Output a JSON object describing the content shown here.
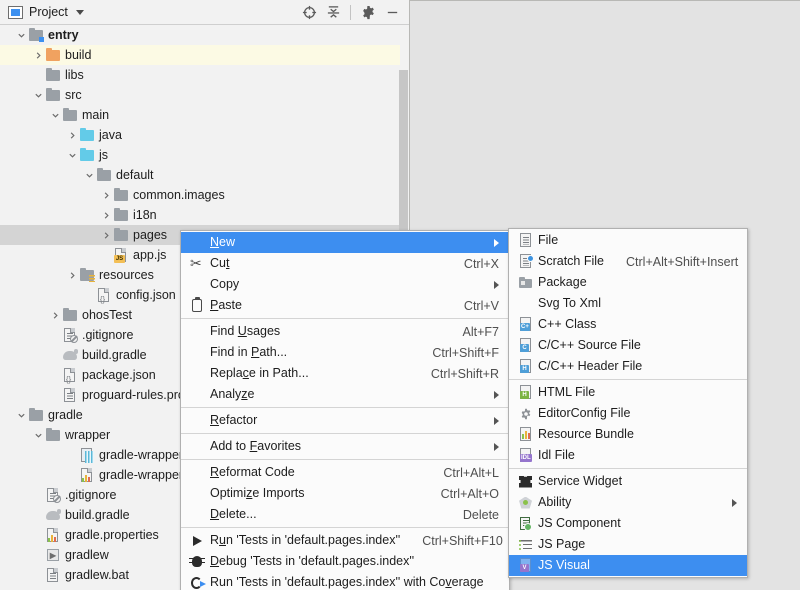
{
  "window": {
    "tool_window_title": "Project",
    "actions": [
      {
        "name": "locate-icon",
        "label": "Select Opened File"
      },
      {
        "name": "collapse-all-icon",
        "label": "Collapse All"
      },
      {
        "name": "gear-icon",
        "label": "Settings"
      },
      {
        "name": "minimize-icon",
        "label": "Hide"
      }
    ]
  },
  "tree": {
    "nodes": [
      {
        "label": "entry",
        "indent": 0,
        "twisty": "down",
        "icon": "folder-module",
        "bold": true,
        "state": "normal"
      },
      {
        "label": "build",
        "indent": 1,
        "twisty": "right",
        "icon": "folder-excluded",
        "bold": false,
        "state": "excluded"
      },
      {
        "label": "libs",
        "indent": 1,
        "twisty": "none",
        "icon": "folder-gray",
        "bold": false,
        "state": "normal"
      },
      {
        "label": "src",
        "indent": 1,
        "twisty": "down",
        "icon": "folder-gray",
        "bold": false,
        "state": "normal"
      },
      {
        "label": "main",
        "indent": 2,
        "twisty": "down",
        "icon": "folder-gray",
        "bold": false,
        "state": "normal"
      },
      {
        "label": "java",
        "indent": 3,
        "twisty": "right",
        "icon": "folder-source",
        "bold": false,
        "state": "normal"
      },
      {
        "label": "js",
        "indent": 3,
        "twisty": "down",
        "icon": "folder-source",
        "bold": false,
        "state": "normal"
      },
      {
        "label": "default",
        "indent": 4,
        "twisty": "down",
        "icon": "folder-gray",
        "bold": false,
        "state": "normal"
      },
      {
        "label": "common.images",
        "indent": 5,
        "twisty": "right",
        "icon": "folder-gray",
        "bold": false,
        "state": "normal"
      },
      {
        "label": "i18n",
        "indent": 5,
        "twisty": "right",
        "icon": "folder-gray",
        "bold": false,
        "state": "normal"
      },
      {
        "label": "pages",
        "indent": 5,
        "twisty": "right",
        "icon": "folder-gray",
        "bold": false,
        "state": "selected"
      },
      {
        "label": "app.js",
        "indent": 5,
        "twisty": "none",
        "icon": "file-js",
        "bold": false,
        "state": "normal"
      },
      {
        "label": "resources",
        "indent": 3,
        "twisty": "right",
        "icon": "folder-resource",
        "bold": false,
        "state": "normal"
      },
      {
        "label": "config.json",
        "indent": 4,
        "twisty": "none",
        "icon": "file-json",
        "bold": false,
        "state": "normal"
      },
      {
        "label": "ohosTest",
        "indent": 2,
        "twisty": "right",
        "icon": "folder-gray",
        "bold": false,
        "state": "normal"
      },
      {
        "label": ".gitignore",
        "indent": 2,
        "twisty": "none",
        "icon": "file-ignored",
        "bold": false,
        "state": "normal"
      },
      {
        "label": "build.gradle",
        "indent": 2,
        "twisty": "none",
        "icon": "file-gradle",
        "bold": false,
        "state": "normal"
      },
      {
        "label": "package.json",
        "indent": 2,
        "twisty": "none",
        "icon": "file-json",
        "bold": false,
        "state": "normal"
      },
      {
        "label": "proguard-rules.pro",
        "indent": 2,
        "twisty": "none",
        "icon": "file-text",
        "bold": false,
        "state": "normal"
      },
      {
        "label": "gradle",
        "indent": 0,
        "twisty": "down",
        "icon": "folder-gray",
        "bold": false,
        "state": "normal"
      },
      {
        "label": "wrapper",
        "indent": 1,
        "twisty": "down",
        "icon": "folder-gray",
        "bold": false,
        "state": "normal"
      },
      {
        "label": "gradle-wrapper.",
        "indent": 3,
        "twisty": "none",
        "icon": "file-archive",
        "bold": false,
        "state": "normal"
      },
      {
        "label": "gradle-wrapper.",
        "indent": 3,
        "twisty": "none",
        "icon": "file-properties",
        "bold": false,
        "state": "normal"
      },
      {
        "label": ".gitignore",
        "indent": 1,
        "twisty": "none",
        "icon": "file-ignored",
        "bold": false,
        "state": "normal"
      },
      {
        "label": "build.gradle",
        "indent": 1,
        "twisty": "none",
        "icon": "file-gradle",
        "bold": false,
        "state": "normal"
      },
      {
        "label": "gradle.properties",
        "indent": 1,
        "twisty": "none",
        "icon": "file-properties",
        "bold": false,
        "state": "normal"
      },
      {
        "label": "gradlew",
        "indent": 1,
        "twisty": "none",
        "icon": "file-script",
        "bold": false,
        "state": "normal"
      },
      {
        "label": "gradlew.bat",
        "indent": 1,
        "twisty": "none",
        "icon": "file-text",
        "bold": false,
        "state": "normal"
      }
    ]
  },
  "context_menu": {
    "items": [
      {
        "kind": "item",
        "label": "New",
        "mnemonic": "N",
        "accel": "",
        "icon": "none",
        "submenu": true,
        "highlighted": true
      },
      {
        "kind": "item",
        "label": "Cut",
        "mnemonic": "t",
        "accel": "Ctrl+X",
        "icon": "scissors-icon",
        "submenu": false,
        "highlighted": false
      },
      {
        "kind": "item",
        "label": "Copy",
        "mnemonic": "",
        "accel": "",
        "icon": "none",
        "submenu": true,
        "highlighted": false
      },
      {
        "kind": "item",
        "label": "Paste",
        "mnemonic": "P",
        "accel": "Ctrl+V",
        "icon": "clipboard-icon",
        "submenu": false,
        "highlighted": false
      },
      {
        "kind": "separator"
      },
      {
        "kind": "item",
        "label": "Find Usages",
        "mnemonic": "U",
        "accel": "Alt+F7",
        "icon": "none",
        "submenu": false,
        "highlighted": false
      },
      {
        "kind": "item",
        "label": "Find in Path...",
        "mnemonic": "P",
        "accel": "Ctrl+Shift+F",
        "icon": "none",
        "submenu": false,
        "highlighted": false
      },
      {
        "kind": "item",
        "label": "Replace in Path...",
        "mnemonic": "c",
        "accel": "Ctrl+Shift+R",
        "icon": "none",
        "submenu": false,
        "highlighted": false
      },
      {
        "kind": "item",
        "label": "Analyze",
        "mnemonic": "z",
        "accel": "",
        "icon": "none",
        "submenu": true,
        "highlighted": false
      },
      {
        "kind": "separator"
      },
      {
        "kind": "item",
        "label": "Refactor",
        "mnemonic": "R",
        "accel": "",
        "icon": "none",
        "submenu": true,
        "highlighted": false
      },
      {
        "kind": "separator"
      },
      {
        "kind": "item",
        "label": "Add to Favorites",
        "mnemonic": "F",
        "accel": "",
        "icon": "none",
        "submenu": true,
        "highlighted": false
      },
      {
        "kind": "separator"
      },
      {
        "kind": "item",
        "label": "Reformat Code",
        "mnemonic": "R",
        "accel": "Ctrl+Alt+L",
        "icon": "none",
        "submenu": false,
        "highlighted": false
      },
      {
        "kind": "item",
        "label": "Optimize Imports",
        "mnemonic": "z",
        "accel": "Ctrl+Alt+O",
        "icon": "none",
        "submenu": false,
        "highlighted": false
      },
      {
        "kind": "item",
        "label": "Delete...",
        "mnemonic": "D",
        "accel": "Delete",
        "icon": "none",
        "submenu": false,
        "highlighted": false
      },
      {
        "kind": "separator"
      },
      {
        "kind": "item",
        "label": "Run 'Tests in 'default.pages.index''",
        "mnemonic": "u",
        "accel": "Ctrl+Shift+F10",
        "icon": "run-icon",
        "submenu": false,
        "highlighted": false
      },
      {
        "kind": "item",
        "label": "Debug 'Tests in 'default.pages.index''",
        "mnemonic": "D",
        "accel": "",
        "icon": "debug-icon",
        "submenu": false,
        "highlighted": false
      },
      {
        "kind": "item",
        "label": "Run 'Tests in 'default.pages.index'' with Coverage",
        "mnemonic": "v",
        "accel": "",
        "icon": "coverage-icon",
        "submenu": false,
        "highlighted": false
      }
    ]
  },
  "new_submenu": {
    "items": [
      {
        "kind": "item",
        "label": "File",
        "accel": "",
        "icon": "file-icon",
        "submenu": false,
        "highlighted": false
      },
      {
        "kind": "item",
        "label": "Scratch File",
        "accel": "Ctrl+Alt+Shift+Insert",
        "icon": "scratch-file-icon",
        "submenu": false,
        "highlighted": false
      },
      {
        "kind": "item",
        "label": "Package",
        "accel": "",
        "icon": "package-icon",
        "submenu": false,
        "highlighted": false
      },
      {
        "kind": "item",
        "label": "Svg To Xml",
        "accel": "",
        "icon": "none",
        "submenu": false,
        "highlighted": false
      },
      {
        "kind": "item",
        "label": "C++ Class",
        "accel": "",
        "icon": "cpp-class-icon",
        "submenu": false,
        "highlighted": false
      },
      {
        "kind": "item",
        "label": "C/C++ Source File",
        "accel": "",
        "icon": "c-source-icon",
        "submenu": false,
        "highlighted": false
      },
      {
        "kind": "item",
        "label": "C/C++ Header File",
        "accel": "",
        "icon": "c-header-icon",
        "submenu": false,
        "highlighted": false
      },
      {
        "kind": "separator"
      },
      {
        "kind": "item",
        "label": "HTML File",
        "accel": "",
        "icon": "html-file-icon",
        "submenu": false,
        "highlighted": false
      },
      {
        "kind": "item",
        "label": "EditorConfig File",
        "accel": "",
        "icon": "editorconfig-icon",
        "submenu": false,
        "highlighted": false
      },
      {
        "kind": "item",
        "label": "Resource Bundle",
        "accel": "",
        "icon": "resource-bundle-icon",
        "submenu": false,
        "highlighted": false
      },
      {
        "kind": "item",
        "label": "Idl File",
        "accel": "",
        "icon": "idl-file-icon",
        "submenu": false,
        "highlighted": false
      },
      {
        "kind": "separator"
      },
      {
        "kind": "item",
        "label": "Service Widget",
        "accel": "",
        "icon": "service-widget-icon",
        "submenu": false,
        "highlighted": false
      },
      {
        "kind": "item",
        "label": "Ability",
        "accel": "",
        "icon": "ability-icon",
        "submenu": true,
        "highlighted": false
      },
      {
        "kind": "item",
        "label": "JS Component",
        "accel": "",
        "icon": "js-component-icon",
        "submenu": false,
        "highlighted": false
      },
      {
        "kind": "item",
        "label": "JS Page",
        "accel": "",
        "icon": "js-page-icon",
        "submenu": false,
        "highlighted": false
      },
      {
        "kind": "item",
        "label": "JS Visual",
        "accel": "",
        "icon": "js-visual-icon",
        "submenu": false,
        "highlighted": true
      }
    ]
  },
  "colors": {
    "accent_highlight": "#3d8ef0",
    "menu_background": "#fbfbfb",
    "panel_background": "#f2f2f2",
    "editor_background": "#e3e3e3",
    "excluded_row": "#fcfae4",
    "selected_inactive_row": "#d4d4d4"
  }
}
